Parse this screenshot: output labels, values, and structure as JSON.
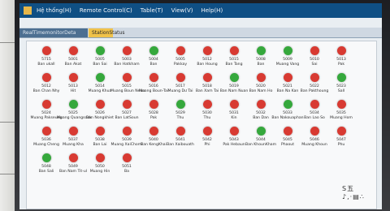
{
  "menu": [
    "Hệ thống(H)",
    "Remote Control(C)",
    "Table(T)",
    "View(V)",
    "Help(H)"
  ],
  "tabs": [
    "RealTimemonitorDeta",
    "StationStatus"
  ],
  "colors": {
    "online": "#35a83c",
    "offline": "#d83a32"
  },
  "stations": [
    {
      "code": "5715",
      "name": "Ban ukall",
      "status": "offline"
    },
    {
      "code": "5001",
      "name": "Ban Akat",
      "status": "offline"
    },
    {
      "code": "5005",
      "name": "Ban Sai",
      "status": "online"
    },
    {
      "code": "5003",
      "name": "Ban Hatkham",
      "status": "offline"
    },
    {
      "code": "5004",
      "name": "Ban",
      "status": "online"
    },
    {
      "code": "5005",
      "name": "Pakkay",
      "status": "offline"
    },
    {
      "code": "5012",
      "name": "Ban Houng",
      "status": "offline"
    },
    {
      "code": "5015",
      "name": "Ban Tang",
      "status": "offline"
    },
    {
      "code": "5008",
      "name": "Ban",
      "status": "online"
    },
    {
      "code": "5009",
      "name": "Muang Vang",
      "status": "online"
    },
    {
      "code": "5010",
      "name": "Sai",
      "status": "offline"
    },
    {
      "code": "5013",
      "name": "Pak",
      "status": "offline"
    },
    {
      "code": "5012",
      "name": "Ban Chan Nhy",
      "status": "offline"
    },
    {
      "code": "5013",
      "name": "Hit",
      "status": "offline"
    },
    {
      "code": "5014",
      "name": "Muang Khua",
      "status": "online"
    },
    {
      "code": "5015",
      "name": "Muang Boun Neua",
      "status": "offline"
    },
    {
      "code": "5016",
      "name": "Muang Boun-Tai",
      "status": "offline"
    },
    {
      "code": "5017",
      "name": "Muang Dư Tai",
      "status": "offline"
    },
    {
      "code": "5018",
      "name": "Ban Xam Tai",
      "status": "offline"
    },
    {
      "code": "5019",
      "name": "Ban Nam Nuan",
      "status": "online"
    },
    {
      "code": "5020",
      "name": "Ban Nam Ho",
      "status": "offline"
    },
    {
      "code": "5021",
      "name": "Ban Na Kan",
      "status": "offline"
    },
    {
      "code": "5022",
      "name": "Ban Pakthoung",
      "status": "offline"
    },
    {
      "code": "5023",
      "name": "Sall",
      "status": "online"
    },
    {
      "code": "5024",
      "name": "Muang Pakseung",
      "status": "offline"
    },
    {
      "code": "5025",
      "name": "Muang Quangsoak",
      "status": "online"
    },
    {
      "code": "5026",
      "name": "Ban Nongkhiet",
      "status": "offline"
    },
    {
      "code": "5027",
      "name": "Ban LatSoun",
      "status": "offline"
    },
    {
      "code": "5028",
      "name": "Pak",
      "status": "offline"
    },
    {
      "code": "5029",
      "name": "Thu",
      "status": "online"
    },
    {
      "code": "5030",
      "name": "Thu",
      "status": "offline"
    },
    {
      "code": "5031",
      "name": "Kin",
      "status": "offline"
    },
    {
      "code": "5032",
      "name": "Ban Dan",
      "status": "offline"
    },
    {
      "code": "5033",
      "name": "Ban Nakouaphan",
      "status": "online"
    },
    {
      "code": "5034",
      "name": "Ban Lao So",
      "status": "offline"
    },
    {
      "code": "5035",
      "name": "Muang Hom",
      "status": "offline"
    },
    {
      "code": "5036",
      "name": "Muang Cheng",
      "status": "offline"
    },
    {
      "code": "5037",
      "name": "Muang Kha",
      "status": "offline"
    },
    {
      "code": "5038",
      "name": "Ban Lai",
      "status": "offline"
    },
    {
      "code": "5039",
      "name": "Muang XaiChomi",
      "status": "offline"
    },
    {
      "code": "5040",
      "name": "Ban KengKhai",
      "status": "offline"
    },
    {
      "code": "5041",
      "name": "Ban Xaibouath",
      "status": "offline"
    },
    {
      "code": "5042",
      "name": "Phi",
      "status": "offline"
    },
    {
      "code": "5043",
      "name": "Pak Hebaun",
      "status": "offline"
    },
    {
      "code": "5044",
      "name": "Ban KhounKham",
      "status": "online"
    },
    {
      "code": "5045",
      "name": "Phaout",
      "status": "offline"
    },
    {
      "code": "5046",
      "name": "Muang Khoun",
      "status": "offline"
    },
    {
      "code": "5047",
      "name": "Phu",
      "status": "offline"
    },
    {
      "code": "5048",
      "name": "Ban Sali",
      "status": "online"
    },
    {
      "code": "5049",
      "name": "Ban Nam Tit-ul",
      "status": "offline"
    },
    {
      "code": "5050",
      "name": "Muang Hin",
      "status": "offline"
    },
    {
      "code": "5051",
      "name": "Ba",
      "status": "offline"
    }
  ],
  "status_icons": "S五♪,·▤∴"
}
